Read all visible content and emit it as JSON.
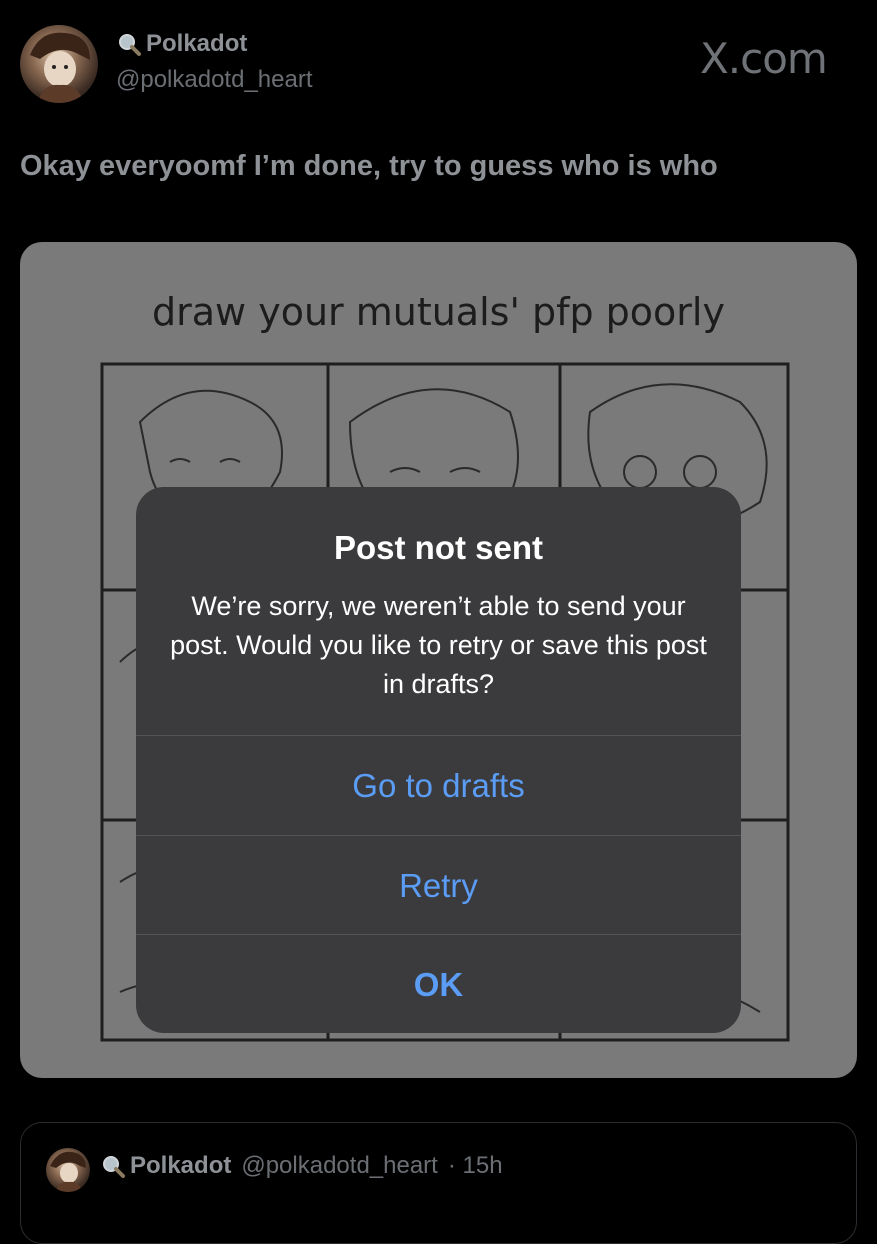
{
  "header": {
    "display_name": "Polkadot",
    "handle": "@polkadotd_heart",
    "name_icon": "magnifier-icon",
    "watermark": "X.com"
  },
  "tweet": {
    "text": "Okay everyoomf I’m done, try to guess who is who"
  },
  "media": {
    "title": "draw your mutuals' pfp poorly"
  },
  "dialog": {
    "title": "Post not sent",
    "message": "We’re sorry, we weren’t able to send your post. Would you like to retry or save this post in drafts?",
    "buttons": {
      "drafts": "Go to drafts",
      "retry": "Retry",
      "ok": "OK"
    },
    "accent_color": "#5b9cf5"
  },
  "reply": {
    "display_name": "Polkadot",
    "handle": "@polkadotd_heart",
    "time": "· 15h"
  }
}
